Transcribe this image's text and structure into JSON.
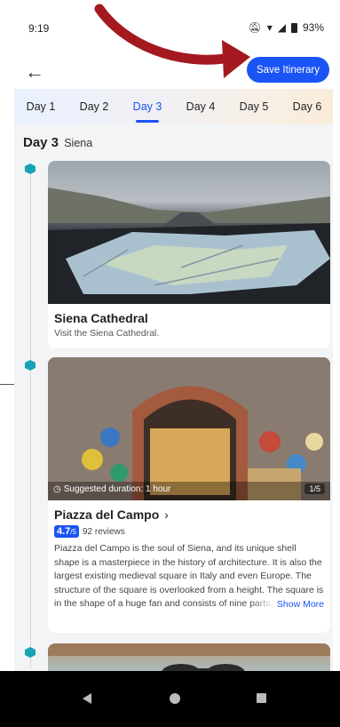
{
  "status_bar": {
    "time": "9:19",
    "battery": "93%"
  },
  "header": {
    "save_label": "Save Itinerary"
  },
  "tabs": [
    {
      "label": "Day 1"
    },
    {
      "label": "Day 2"
    },
    {
      "label": "Day 3"
    },
    {
      "label": "Day 4"
    },
    {
      "label": "Day 5"
    },
    {
      "label": "Day 6"
    }
  ],
  "active_tab_index": 2,
  "day_header": {
    "day": "Day 3",
    "city": "Siena"
  },
  "cards": [
    {
      "title": "Siena Cathedral",
      "description": "Visit the Siena Cathedral."
    },
    {
      "title": "Piazza del Campo",
      "rating": "4.7",
      "rating_scale": "/5",
      "reviews": "92 reviews",
      "description": "Piazza del Campo is the soul of Siena, and its unique shell shape is a masterpiece in the history of architecture. It is also the largest existing medieval square in Italy and even Europe. The structure of the square is overlooked from a height. The square is in the shape of a huge fan and consists of nine parts, representing the nine",
      "show_more": "Show More",
      "photo_caption": "Suggested duration: 1 hour",
      "photo_counter": "1/5"
    }
  ],
  "colors": {
    "accent": "#1b54f5",
    "marker": "#18a3b5",
    "arrow": "#a3191f"
  }
}
